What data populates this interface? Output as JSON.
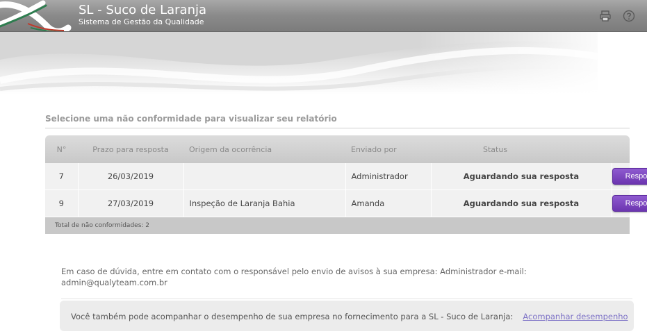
{
  "header": {
    "title": "SL - Suco de Laranja",
    "subtitle": "Sistema de Gestão da Qualidade",
    "icons": [
      "print-icon",
      "help-icon"
    ]
  },
  "section": {
    "title": "Selecione uma não conformidade para visualizar seu relatório"
  },
  "table": {
    "columns": {
      "num": "N°",
      "prazo": "Prazo para resposta",
      "origem": "Origem da ocorrência",
      "enviado": "Enviado por",
      "status": "Status"
    },
    "rows": [
      {
        "num": "7",
        "prazo": "26/03/2019",
        "origem": "",
        "enviado": "Administrador",
        "status": "Aguardando sua resposta",
        "action": "Responder"
      },
      {
        "num": "9",
        "prazo": "27/03/2019",
        "origem": "Inspeção de Laranja Bahia",
        "enviado": "Amanda",
        "status": "Aguardando sua resposta",
        "action": "Responder"
      }
    ],
    "footer": "Total de não conformidades: 2"
  },
  "contact": {
    "text": "Em caso de dúvida, entre em contato com o responsável pelo envio de avisos à sua empresa: Administrador e-mail: admin@qualyteam.com.br"
  },
  "performance": {
    "text": "Você também pode acompanhar o desempenho de sua empresa no fornecimento para a SL - Suco de Laranja:",
    "link": "Acompanhar desempenho"
  },
  "colors": {
    "accent_button": "#7a44bf",
    "link": "#7d72c6",
    "header_bg": "#8a8a8a"
  }
}
